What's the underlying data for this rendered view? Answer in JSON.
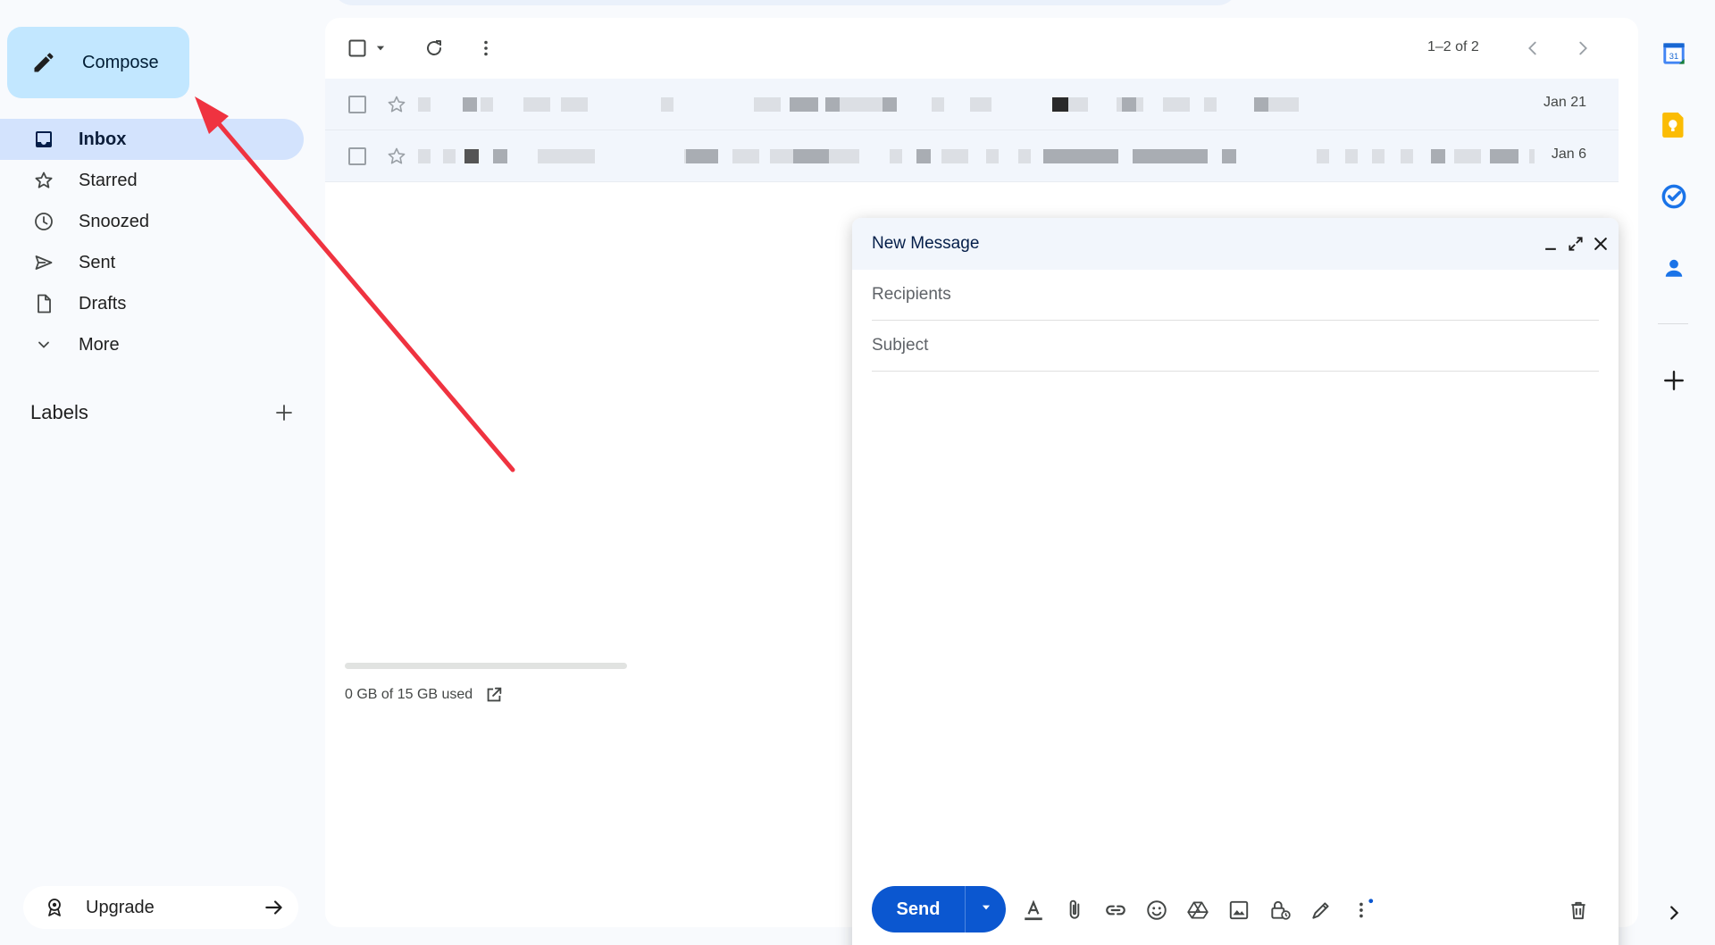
{
  "sidebar": {
    "compose_label": "Compose",
    "items": [
      {
        "label": "Inbox",
        "icon": "inbox-icon",
        "active": true
      },
      {
        "label": "Starred",
        "icon": "star-icon"
      },
      {
        "label": "Snoozed",
        "icon": "clock-icon"
      },
      {
        "label": "Sent",
        "icon": "send-icon"
      },
      {
        "label": "Drafts",
        "icon": "draft-icon"
      },
      {
        "label": "More",
        "icon": "chevron-down-icon"
      }
    ],
    "labels_title": "Labels",
    "upgrade_label": "Upgrade"
  },
  "toolbar": {
    "pager": "1–2 of 2"
  },
  "mails": [
    {
      "date": "Jan 21",
      "content": "redacted"
    },
    {
      "date": "Jan 6",
      "content": "redacted"
    }
  ],
  "storage": {
    "text": "0 GB of 15 GB used",
    "used_fraction": 0
  },
  "compose_window": {
    "title": "New Message",
    "recipients_placeholder": "Recipients",
    "subject_placeholder": "Subject",
    "send_label": "Send"
  },
  "right_rail": {
    "calendar_day": "31"
  },
  "colors": {
    "accent": "#0b57d0",
    "compose_bg": "#c2e7ff",
    "active_nav": "#d3e3fd",
    "annotation_arrow": "#ef3340"
  }
}
